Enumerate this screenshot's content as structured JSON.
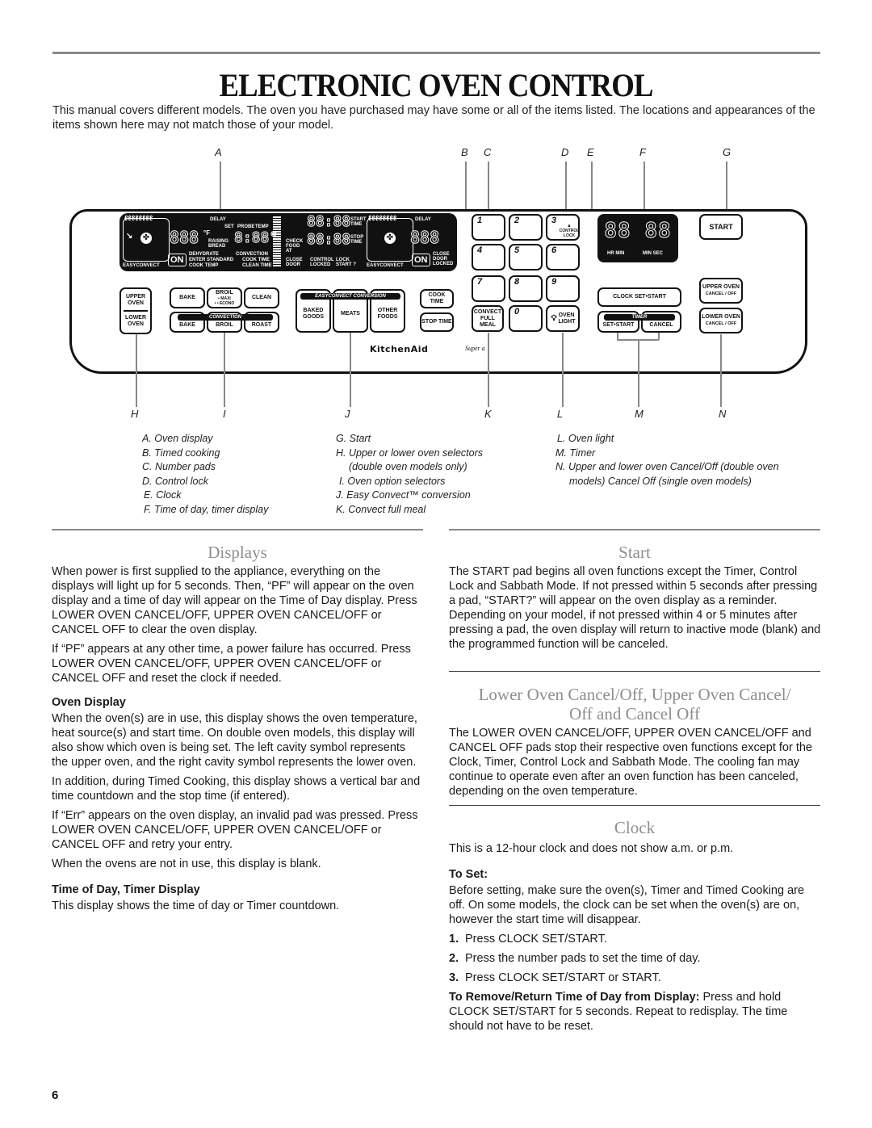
{
  "page": {
    "title": "ELECTRONIC OVEN CONTROL",
    "intro": "This manual covers different models. The oven you have purchased may have some or all of the items listed. The locations and appearances of the items shown here may not match those of your model.",
    "page_number": "6"
  },
  "diagram": {
    "top_letters": [
      "A",
      "B",
      "C",
      "D",
      "E",
      "F",
      "G"
    ],
    "bottom_letters": [
      "H",
      "I",
      "J",
      "K",
      "L",
      "M",
      "N"
    ],
    "lcd": {
      "easyconvect": "EASYCONVECT",
      "delay": "DELAY",
      "set": "SET",
      "probe": "PROBE",
      "temp": "TEMP",
      "temp_digits": "888",
      "degree_f": "°F",
      "raising_bread": "RAISING BREAD",
      "probe_digits": "8:88°",
      "dehydrate": "DEHYDRATE",
      "enter_standard": "ENTER STANDARD",
      "cook_temp": "COOK TEMP",
      "convection": "CONVECTION",
      "cook_time": "COOK TIME",
      "clean_time": "CLEAN TIME",
      "on": "ON",
      "time_digits": "88:88",
      "start_time": "START TIME",
      "stop_time": "STOP TIME",
      "check_food_at": "CHECK FOOD AT",
      "close_door": "CLOSE DOOR",
      "control_locked": "CONTROL LOCKED",
      "lock_start": "LOCK START ?",
      "close_door_locked": "CLOSE DOOR LOCKED"
    },
    "pads": {
      "upper_oven": "UPPER OVEN",
      "lower_oven": "LOWER OVEN",
      "bake": "BAKE",
      "broil": "BROIL",
      "broil_maxi": "• MAXI",
      "broil_econo": "• • ECONO",
      "clean": "CLEAN",
      "convection_band": "CONVECTION",
      "conv_bake": "BAKE",
      "conv_broil": "BROIL",
      "conv_roast": "ROAST",
      "easyconvect_band": "EASYCONVECT CONVERSION",
      "baked_goods": "BAKED GOODS",
      "meats": "MEATS",
      "other_foods": "OTHER FOODS",
      "cook_time": "COOK TIME",
      "stop_time": "STOP TIME",
      "numbers": [
        "1",
        "2",
        "3",
        "4",
        "5",
        "6",
        "7",
        "8",
        "9",
        "0"
      ],
      "control_lock": "CONTROL LOCK",
      "convect_full_meal": "CONVECT FULL MEAL",
      "oven_light": "OVEN LIGHT",
      "clock_set_start": "CLOCK SET•START",
      "timer_band": "TIMER",
      "timer_set_start": "SET•START",
      "timer_cancel": "CANCEL",
      "start": "START",
      "upper_oven_cancel": "UPPER OVEN",
      "lower_oven_cancel": "LOWER OVEN",
      "cancel_off": "CANCEL / OFF"
    },
    "clock_display": {
      "digits": "88 88",
      "hr_min": "HR MIN",
      "min_sec": "MIN SEC"
    },
    "brand": "KitchenAid",
    "brand_sub": "Super a"
  },
  "legend": {
    "col1": [
      "A. Oven display",
      "B. Timed cooking",
      "C. Number pads",
      "D. Control lock",
      "E. Clock",
      "F. Time of day, timer display"
    ],
    "col2": [
      "G. Start",
      "H. Upper or lower oven selectors",
      "(double oven models only)",
      "I. Oven option selectors",
      "J. Easy Convect™ conversion",
      "K. Convect full meal"
    ],
    "col3": [
      "L. Oven light",
      "M. Timer",
      "N. Upper and lower oven Cancel/Off (double oven",
      "models) Cancel Off (single oven models)"
    ]
  },
  "displays": {
    "heading": "Displays",
    "p1": "When power is first supplied to the appliance, everything on the displays will light up for 5 seconds. Then, “PF” will appear on the oven display and a time of day will appear on the Time of Day display. Press LOWER OVEN CANCEL/OFF, UPPER OVEN CANCEL/OFF or CANCEL OFF to clear the oven display.",
    "p2": "If “PF” appears at any other time, a power failure has occurred. Press LOWER OVEN CANCEL/OFF, UPPER OVEN CANCEL/OFF or CANCEL OFF and reset the clock if needed.",
    "oven_display_heading": "Oven Display",
    "od_p1": "When the oven(s) are in use, this display shows the oven temperature, heat source(s) and start time. On double oven models, this display will also show which oven is being set. The left cavity symbol represents the upper oven, and the right cavity symbol represents the lower oven.",
    "od_p2": "In addition, during Timed Cooking, this display shows a vertical bar and time countdown and the stop time (if entered).",
    "od_p3": "If “Err” appears on the oven display, an invalid pad was pressed. Press LOWER OVEN CANCEL/OFF, UPPER OVEN CANCEL/OFF or CANCEL OFF and retry your entry.",
    "od_p4": "When the ovens are not in use, this display is blank.",
    "tod_heading": "Time of Day, Timer Display",
    "tod_p1": "This display shows the time of day or Timer countdown."
  },
  "start": {
    "heading": "Start",
    "p1": "The START pad begins all oven functions except the Timer, Control Lock and Sabbath Mode. If not pressed within 5 seconds after pressing a pad, “START?” will appear on the oven display as a reminder. Depending on your model, if not pressed within 4 or 5 minutes after pressing a pad, the oven display will return to inactive mode (blank) and the programmed function will be canceled."
  },
  "cancel": {
    "heading_line1": "Lower Oven Cancel/Off, Upper Oven Cancel/",
    "heading_line2": "Off and Cancel Off",
    "p1": "The LOWER OVEN CANCEL/OFF, UPPER OVEN CANCEL/OFF and CANCEL OFF pads stop their respective oven functions except for the Clock, Timer, Control Lock and Sabbath Mode. The cooling fan may continue to operate even after an oven function has been canceled, depending on the oven temperature."
  },
  "clock": {
    "heading": "Clock",
    "p1": "This is a 12-hour clock and does not show a.m. or p.m.",
    "to_set_heading": "To Set:",
    "to_set_p": "Before setting, make sure the oven(s), Timer and Timed Cooking are off. On some models, the clock can be set when the oven(s) are on, however the start time will disappear.",
    "steps": [
      {
        "num": "1.",
        "text": "Press CLOCK SET/START."
      },
      {
        "num": "2.",
        "text": "Press the number pads to set the time of day."
      },
      {
        "num": "3.",
        "text": "Press CLOCK SET/START or START."
      }
    ],
    "remove_label": "To Remove/Return Time of Day from Display:",
    "remove_text": " Press and hold CLOCK SET/START for 5 seconds. Repeat to redisplay. The time should not have to be reset."
  }
}
